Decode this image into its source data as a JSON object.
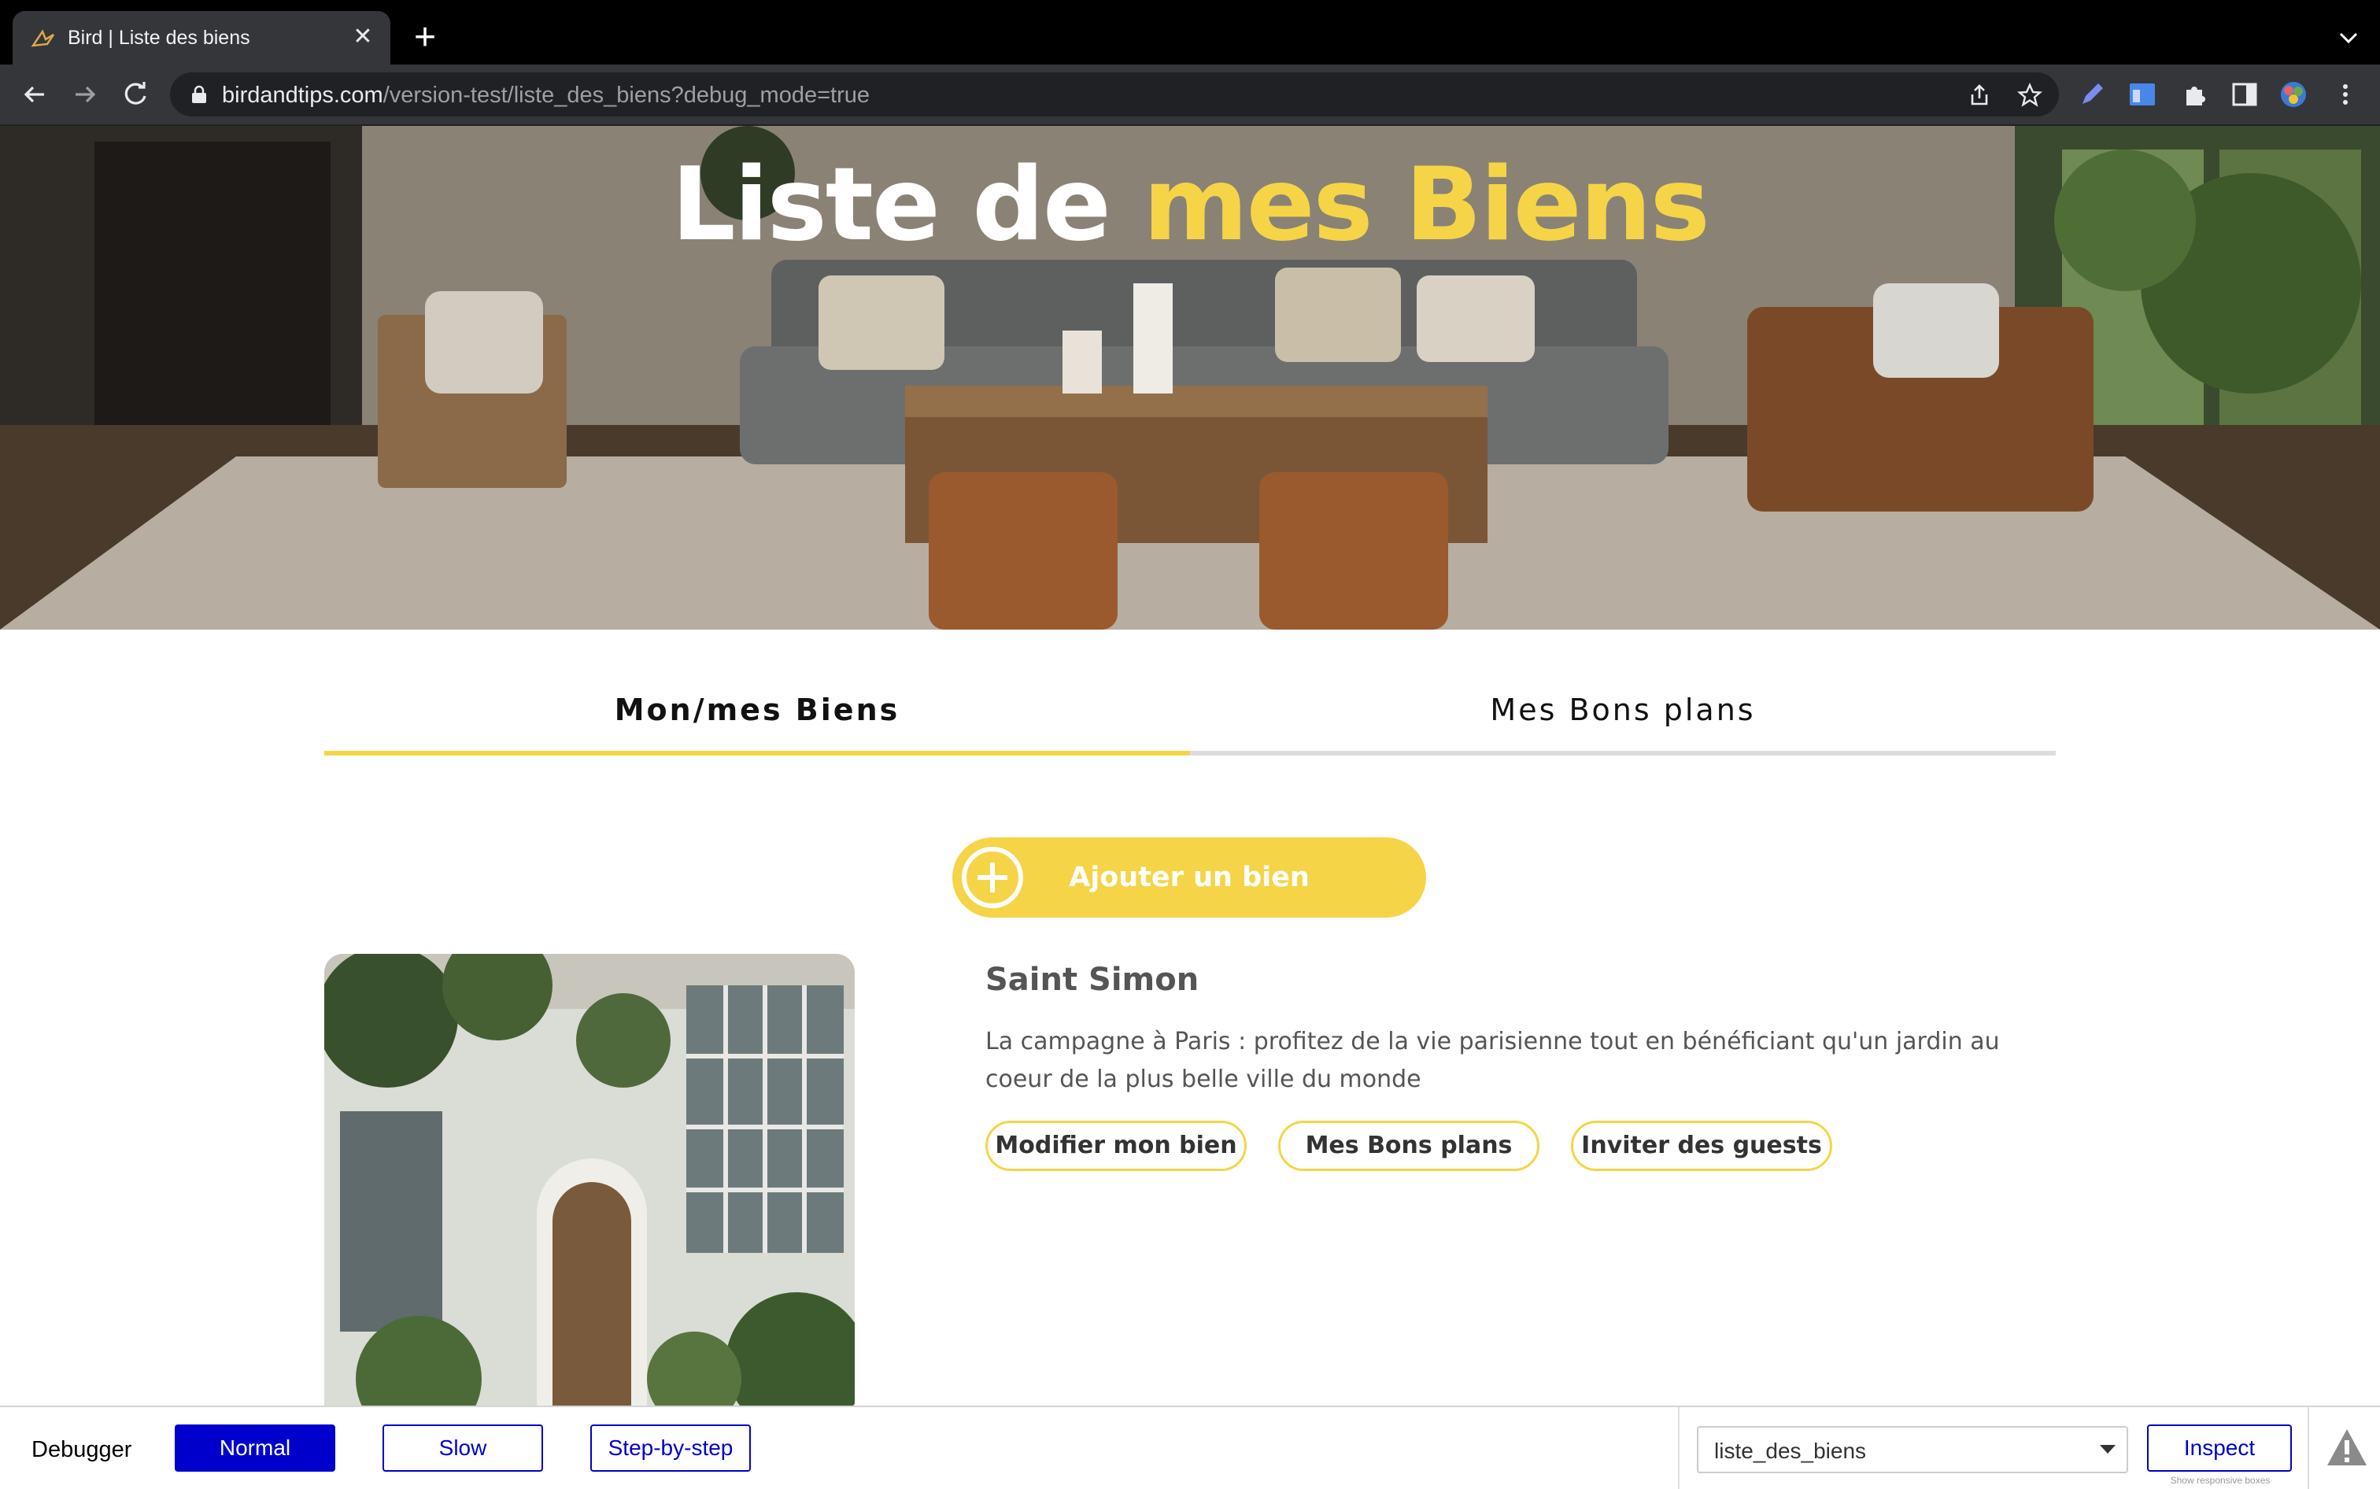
{
  "browser": {
    "tab_title": "Bird | Liste des biens",
    "url_host": "birdandtips.com",
    "url_path": "/version-test/liste_des_biens?debug_mode=true"
  },
  "hero": {
    "title_white": "Liste de",
    "title_accent": "mes Biens"
  },
  "tabs": [
    {
      "label": "Mon/mes Biens",
      "active": true
    },
    {
      "label": "Mes Bons plans",
      "active": false
    }
  ],
  "add_button": {
    "label": "Ajouter un bien"
  },
  "property": {
    "title": "Saint Simon",
    "description": "La campagne à Paris : profitez de la vie parisienne tout en bénéficiant qu'un jardin au coeur de la plus belle ville du monde",
    "actions": [
      "Modifier mon bien",
      "Mes Bons plans",
      "Inviter des guests"
    ]
  },
  "debugger": {
    "label": "Debugger",
    "modes": [
      "Normal",
      "Slow",
      "Step-by-step"
    ],
    "active_mode": "Normal",
    "page_select": "liste_des_biens",
    "inspect_label": "Inspect",
    "hint": "Show responsive boxes"
  },
  "colors": {
    "accent": "#f5d547",
    "debug_blue": "#0000cc"
  }
}
